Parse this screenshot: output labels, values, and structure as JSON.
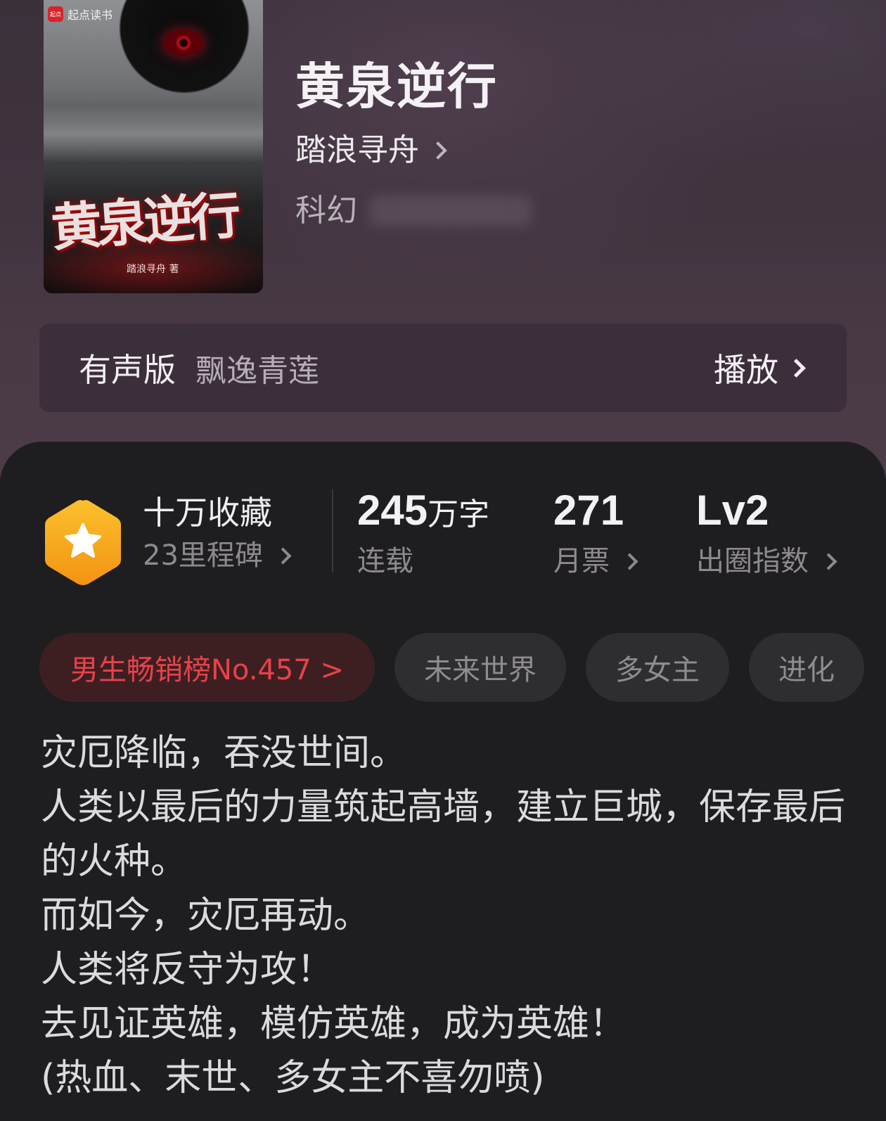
{
  "book": {
    "title": "黄泉逆行",
    "author": "踏浪寻舟",
    "genre": "科幻",
    "cover": {
      "publisher": "起点读书",
      "title": "黄泉逆行",
      "author_line": "踏浪寻舟 著"
    }
  },
  "audio": {
    "label": "有声版",
    "narrator": "飘逸青莲",
    "play_label": "播放"
  },
  "stats": {
    "collect": {
      "title": "十万收藏",
      "sub": "23里程碑"
    },
    "words": {
      "value": "245",
      "unit": "万字",
      "sub": "连载"
    },
    "monthly_votes": {
      "value": "271",
      "sub": "月票"
    },
    "level": {
      "value": "Lv2",
      "sub": "出圈指数"
    }
  },
  "tags": {
    "rank": "男生畅销榜No.457 >",
    "items": [
      "未来世界",
      "多女主",
      "进化"
    ]
  },
  "description": [
    "灾厄降临，吞没世间。",
    "人类以最后的力量筑起高墙，建立巨城，保存最后的火种。",
    "而如今，灾厄再动。",
    "人类将反守为攻！",
    "去见证英雄，模仿英雄，成为英雄！",
    "(热血、末世、多女主不喜勿喷)"
  ],
  "colors": {
    "accent_red": "#e8424a",
    "badge_gold": "#f5a623",
    "background": "#1e1d1f"
  }
}
